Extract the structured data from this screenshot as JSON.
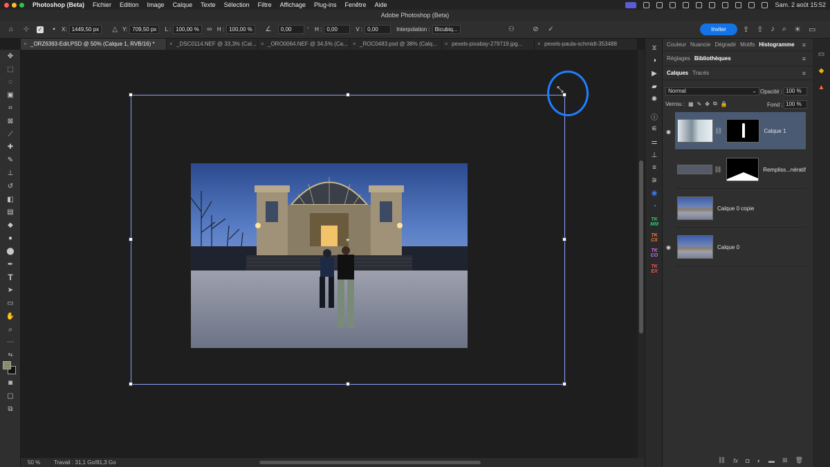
{
  "menubar": {
    "app_name": "Photoshop (Beta)",
    "items": [
      "Fichier",
      "Edition",
      "Image",
      "Calque",
      "Texte",
      "Sélection",
      "Filtre",
      "Affichage",
      "Plug-ins",
      "Fenêtre",
      "Aide"
    ],
    "datetime": "Sam. 2 août  15:52"
  },
  "window": {
    "title": "Adobe Photoshop (Beta)"
  },
  "options": {
    "x_label": "X:",
    "x_value": "1449,50 px",
    "y_label": "Y:",
    "y_value": "709,50 px",
    "w_label": "L :",
    "w_value": "100,00 %",
    "h_label": "H :",
    "h_value": "100,00 %",
    "angle_value": "0,00",
    "hskew_label": "H :",
    "hskew_value": "0,00",
    "vskew_label": "V :",
    "vskew_value": "0,00",
    "interp_label": "Interpolation :",
    "interp_value": "Bicubiq...",
    "invite_label": "Inviter"
  },
  "tabs": [
    {
      "label": "_ORZ6393-Edit.PSD @ 50% (Calque 1, RVB/16) *",
      "active": true
    },
    {
      "label": "_DSC0114.NEF @ 33,3% (Cal...",
      "active": false
    },
    {
      "label": "_ORO0064.NEF @ 34,5% (Ca...",
      "active": false
    },
    {
      "label": "_ROC0483.psd @ 38% (Calq...",
      "active": false
    },
    {
      "label": "pexels-pixabay-279719.jpg...",
      "active": false
    },
    {
      "label": "pexels-paula-schmidt-353488",
      "active": false
    }
  ],
  "status": {
    "zoom": "50 %",
    "work": "Travail : 31,1 Go/81,3 Go"
  },
  "panel": {
    "top_tabs": [
      "Couleur",
      "Nuancie",
      "Dégradé",
      "Motifs",
      "Histogramme"
    ],
    "active_top": "Histogramme",
    "mid_tabs": [
      "Réglages",
      "Bibliothèques"
    ],
    "active_mid": "Bibliothèques",
    "layer_tabs": [
      "Calques",
      "Tracés"
    ],
    "active_layer_tab": "Calques",
    "blend_mode": "Normal",
    "opacity_label": "Opacité :",
    "opacity_value": "100 %",
    "lock_label": "Verrou :",
    "fill_label": "Fond :",
    "fill_value": "100 %",
    "layers": [
      {
        "name": "Calque 1",
        "visible": true,
        "selected": true
      },
      {
        "name": "Rempliss...nératif",
        "visible": false,
        "selected": false
      },
      {
        "name": "Calque 0 copie",
        "visible": false,
        "selected": false
      },
      {
        "name": "Calque 0",
        "visible": true,
        "selected": false
      }
    ]
  },
  "colors": {
    "accent": "#1473e6",
    "highlight_ring": "#1f7fff",
    "selected_layer": "#4a5a73"
  }
}
